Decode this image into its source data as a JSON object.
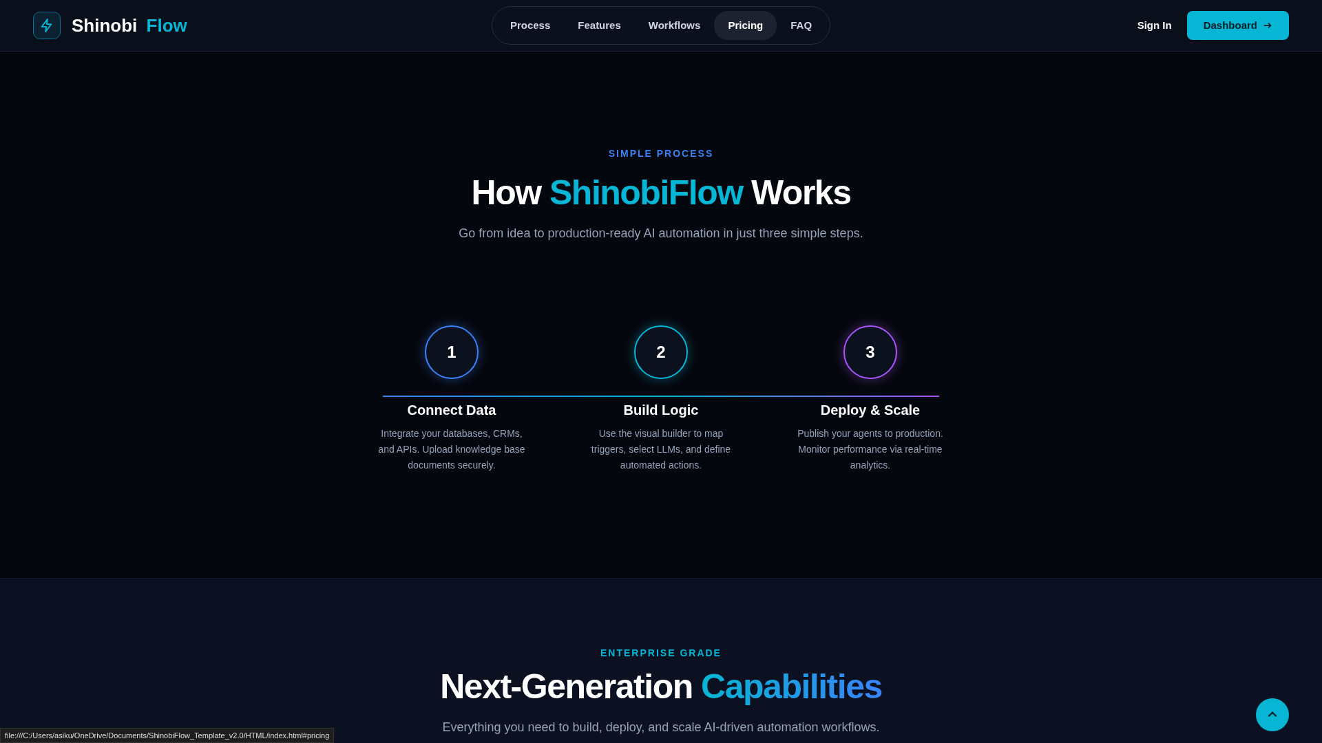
{
  "brand": {
    "name": "Shinobi",
    "accent": "Flow"
  },
  "nav": [
    {
      "label": "Process",
      "selected": false
    },
    {
      "label": "Features",
      "selected": false
    },
    {
      "label": "Workflows",
      "selected": false
    },
    {
      "label": "Pricing",
      "selected": true
    },
    {
      "label": "FAQ",
      "selected": false
    }
  ],
  "sign_in": "Sign In",
  "dashboard": "Dashboard",
  "process": {
    "eyebrow": "SIMPLE PROCESS",
    "title": [
      "How ",
      "ShinobiFlow",
      " Works"
    ],
    "subtitle": "Go from idea to production-ready AI automation in just three simple steps.",
    "steps": [
      {
        "number": "1",
        "title": "Connect Data",
        "text": "Integrate your databases, CRMs, and APIs. Upload knowledge base documents securely.",
        "color": "#3b82f6"
      },
      {
        "number": "2",
        "title": "Build Logic",
        "text": "Use the visual builder to map triggers, select LLMs, and define automated actions.",
        "color": "#06b6d4"
      },
      {
        "number": "3",
        "title": "Deploy & Scale",
        "text": "Publish your agents to production. Monitor performance via real-time analytics.",
        "color": "#a855f7"
      }
    ]
  },
  "capabilities": {
    "eyebrow": "ENTERPRISE GRADE",
    "title": [
      "Next-Generation ",
      "Capabilities"
    ],
    "subtitle": "Everything you need to build, deploy, and scale AI-driven automation workflows."
  },
  "status_bar": "file:///C:/Users/asiku/OneDrive/Documents/ShinobiFlow_Template_v2.0/HTML/index.html#pricing"
}
